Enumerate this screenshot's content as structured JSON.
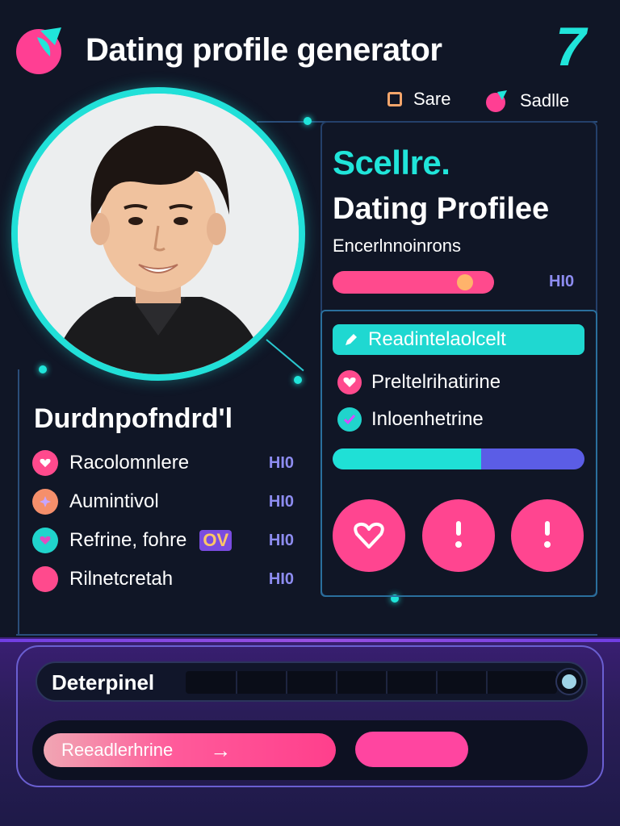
{
  "header": {
    "title": "Dating profile generator",
    "corner_mark": "7",
    "options": [
      {
        "label": "Sare",
        "icon": "checkbox-icon"
      },
      {
        "label": "Sadlle",
        "icon": "settings-blob-icon"
      }
    ]
  },
  "profile": {
    "brand": "Scellre.",
    "title": "Dating Profilee",
    "subtitle": "Encerlnnoinrons",
    "progress_value_text": "HI0",
    "progress_fraction": 0.82,
    "highlight": "Readintelaolcelt",
    "features": [
      {
        "label": "Preltelrihatirine",
        "icon": "heart-icon"
      },
      {
        "label": "Inloenhetrine",
        "icon": "check-icon"
      }
    ],
    "match_fraction": 0.59,
    "actions": [
      {
        "name": "like",
        "icon": "heart-outline-icon"
      },
      {
        "name": "info",
        "icon": "exclamation-icon"
      },
      {
        "name": "info",
        "icon": "exclamation-icon"
      }
    ]
  },
  "details": {
    "title": "Durdnpofndrd'l",
    "items": [
      {
        "label": "Racolomnlere",
        "value": "HI0",
        "color": "#ff4a8d",
        "icon": "heart-icon"
      },
      {
        "label": "Aumintivol",
        "value": "HI0",
        "color": "#f58f6b",
        "icon": "sparkle-icon"
      },
      {
        "label": "Refrine, fohre",
        "tag": "OV",
        "value": "HI0",
        "color": "#20d4cc",
        "icon": "heart-icon"
      },
      {
        "label": "Rilnetcretah",
        "value": "HI0",
        "color": "#ff4a8d",
        "icon": "dot-icon"
      }
    ]
  },
  "composer": {
    "label": "Deterpinel",
    "generate_label": "Reeadlerhrine",
    "generate_arrow": "→"
  },
  "colors": {
    "accent_teal": "#20e5da",
    "accent_pink": "#ff4590",
    "background": "#101626",
    "accent_purple": "#7e46ff"
  }
}
